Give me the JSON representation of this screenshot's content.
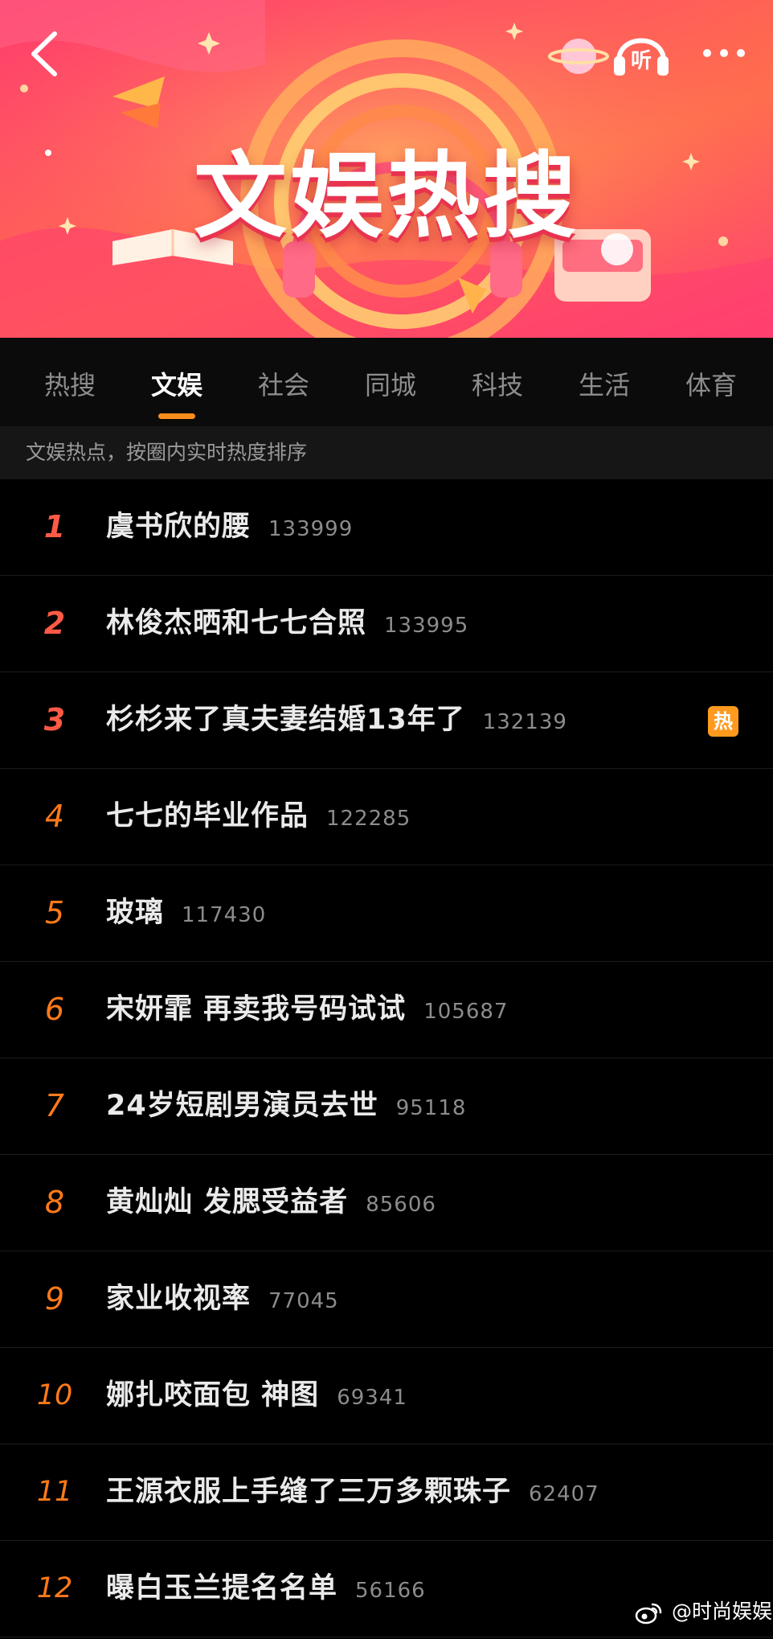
{
  "banner": {
    "title": "文娱热搜",
    "listen_icon_text": "听"
  },
  "tabs": [
    {
      "label": "热搜"
    },
    {
      "label": "文娱",
      "active": true
    },
    {
      "label": "社会"
    },
    {
      "label": "同城"
    },
    {
      "label": "科技"
    },
    {
      "label": "生活"
    },
    {
      "label": "体育"
    }
  ],
  "subheader": "文娱热点，按圈内实时热度排序",
  "hot_badge_label": "热",
  "items": [
    {
      "rank": "1",
      "title": "虞书欣的腰",
      "count": "133999"
    },
    {
      "rank": "2",
      "title": "林俊杰晒和七七合照",
      "count": "133995"
    },
    {
      "rank": "3",
      "title": "杉杉来了真夫妻结婚13年了",
      "count": "132139",
      "hot": true
    },
    {
      "rank": "4",
      "title": "七七的毕业作品",
      "count": "122285"
    },
    {
      "rank": "5",
      "title": "玻璃",
      "count": "117430"
    },
    {
      "rank": "6",
      "title": "宋妍霏 再卖我号码试试",
      "count": "105687"
    },
    {
      "rank": "7",
      "title": "24岁短剧男演员去世",
      "count": "95118"
    },
    {
      "rank": "8",
      "title": "黄灿灿 发腮受益者",
      "count": "85606"
    },
    {
      "rank": "9",
      "title": "家业收视率",
      "count": "77045"
    },
    {
      "rank": "10",
      "title": "娜扎咬面包 神图",
      "count": "69341"
    },
    {
      "rank": "11",
      "title": "王源衣服上手缝了三万多颗珠子",
      "count": "62407"
    },
    {
      "rank": "12",
      "title": "曝白玉兰提名名单",
      "count": "56166"
    }
  ],
  "watermark": "@时尚娱娱",
  "colors": {
    "accent": "#ff8d1a",
    "rank_top": "#ff5a45",
    "rank": "#ff7a1a",
    "hot_badge": "#ff9a1f",
    "banner": "#ff4f62"
  }
}
